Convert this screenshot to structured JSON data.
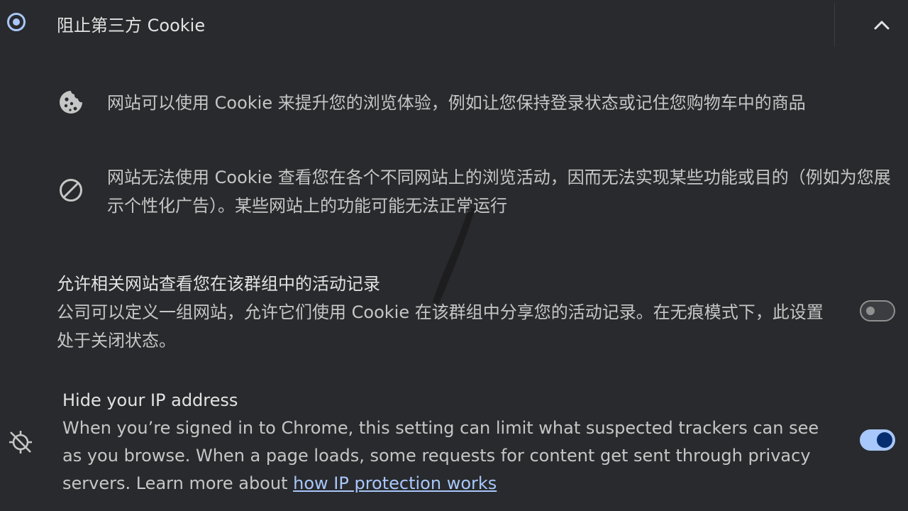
{
  "header": {
    "title": "阻止第三方 Cookie",
    "radio_icon": "radio-selected-icon",
    "collapse_icon": "chevron-up-icon"
  },
  "bullets": [
    {
      "icon": "cookie-icon",
      "text": "网站可以使用 Cookie 来提升您的浏览体验，例如让您保持登录状态或记住您购物车中的商品"
    },
    {
      "icon": "block-icon",
      "text": "网站无法使用 Cookie 查看您在各个不同网站上的浏览活动，因而无法实现某些功能或目的（例如为您展示个性化广告）。某些网站上的功能可能无法正常运行"
    }
  ],
  "related_sites": {
    "title": "允许相关网站查看您在该群组中的活动记录",
    "description": "公司可以定义一组网站，允许它们使用 Cookie 在该群组中分享您的活动记录。在无痕模式下，此设置处于关闭状态。",
    "toggle_state": "off"
  },
  "ip_protection": {
    "icon": "location-off-icon",
    "title": "Hide your IP address",
    "description": "When you’re signed in to Chrome, this setting can limit what suspected trackers can see as you browse. When a page loads, some requests for content get sent through privacy servers. Learn more about ",
    "link_text": "how IP protection works",
    "toggle_state": "on"
  },
  "colors": {
    "background": "#292a2d",
    "accent": "#a8c7fa",
    "text_primary": "#e3e3e3",
    "text_secondary": "#c4c7c5"
  }
}
